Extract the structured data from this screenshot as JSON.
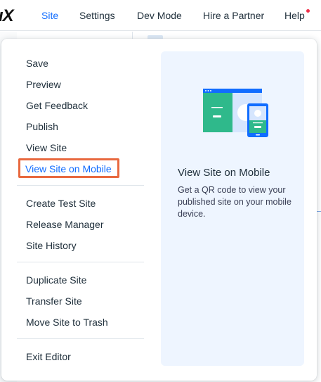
{
  "topbar": {
    "logo": "ıX",
    "nav": [
      {
        "label": "Site"
      },
      {
        "label": "Settings"
      },
      {
        "label": "Dev Mode"
      },
      {
        "label": "Hire a Partner"
      },
      {
        "label": "Help"
      }
    ]
  },
  "menu": {
    "items": [
      {
        "label": "Save"
      },
      {
        "label": "Preview"
      },
      {
        "label": "Get Feedback"
      },
      {
        "label": "Publish"
      },
      {
        "label": "View Site"
      },
      {
        "label": "View Site on Mobile"
      },
      {
        "label": "Create Test Site"
      },
      {
        "label": "Release Manager"
      },
      {
        "label": "Site History"
      },
      {
        "label": "Duplicate Site"
      },
      {
        "label": "Transfer Site"
      },
      {
        "label": "Move Site to Trash"
      },
      {
        "label": "Exit Editor"
      }
    ]
  },
  "info": {
    "title": "View Site on Mobile",
    "description": "Get a QR code to view your published site on your mobile device.",
    "illustration_icon": "desktop-and-mobile-icon"
  },
  "colors": {
    "accent": "#116dff",
    "focus_ring": "#e8693f",
    "panel_bg": "#eef5ff",
    "illustration_green": "#2fb98b",
    "illustration_blue": "#116dff"
  }
}
